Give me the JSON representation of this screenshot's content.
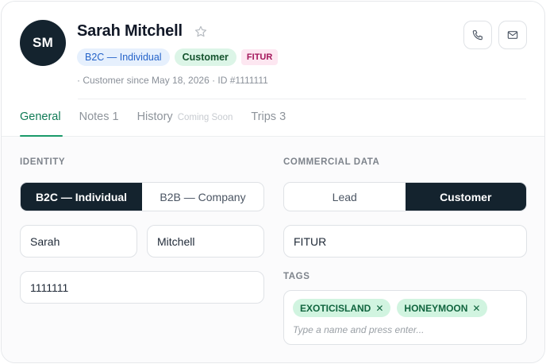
{
  "contact": {
    "initials": "SM",
    "name": "Sarah Mitchell",
    "badges": {
      "type": "B2C — Individual",
      "status": "Customer",
      "source": "FITUR"
    },
    "meta": "· Customer since May 18, 2026 · ID #1111111"
  },
  "header_actions": {
    "call_icon": "phone-icon",
    "mail_icon": "mail-icon"
  },
  "tabs": [
    {
      "label": "General",
      "count": "",
      "note": "",
      "active": true
    },
    {
      "label": "Notes",
      "count": "1",
      "note": "",
      "active": false
    },
    {
      "label": "History",
      "count": "",
      "note": "Coming Soon",
      "active": false
    },
    {
      "label": "Trips",
      "count": "3",
      "note": "",
      "active": false
    }
  ],
  "identity": {
    "title": "IDENTITY",
    "type_options": [
      "B2C — Individual",
      "B2B — Company"
    ],
    "selected_type": "B2C — Individual",
    "first_name": "Sarah",
    "last_name": "Mitchell",
    "id_value": "1111111"
  },
  "commercial": {
    "title": "COMMERCIAL DATA",
    "stage_options": [
      "Lead",
      "Customer"
    ],
    "selected_stage": "Customer",
    "source_value": "FITUR",
    "tags_title": "TAGS",
    "tags": [
      "EXOTICISLAND",
      "HONEYMOON"
    ],
    "tags_placeholder": "Type a name and press enter..."
  },
  "colors": {
    "primary_dark": "#14232e",
    "accent_green": "#1a9a6a",
    "b2c_badge_bg": "#e6f0fd",
    "customer_badge_bg": "#dcf5e7",
    "fitur_badge_bg": "#fde7f1",
    "tag_chip_bg": "#d1f4e0"
  }
}
